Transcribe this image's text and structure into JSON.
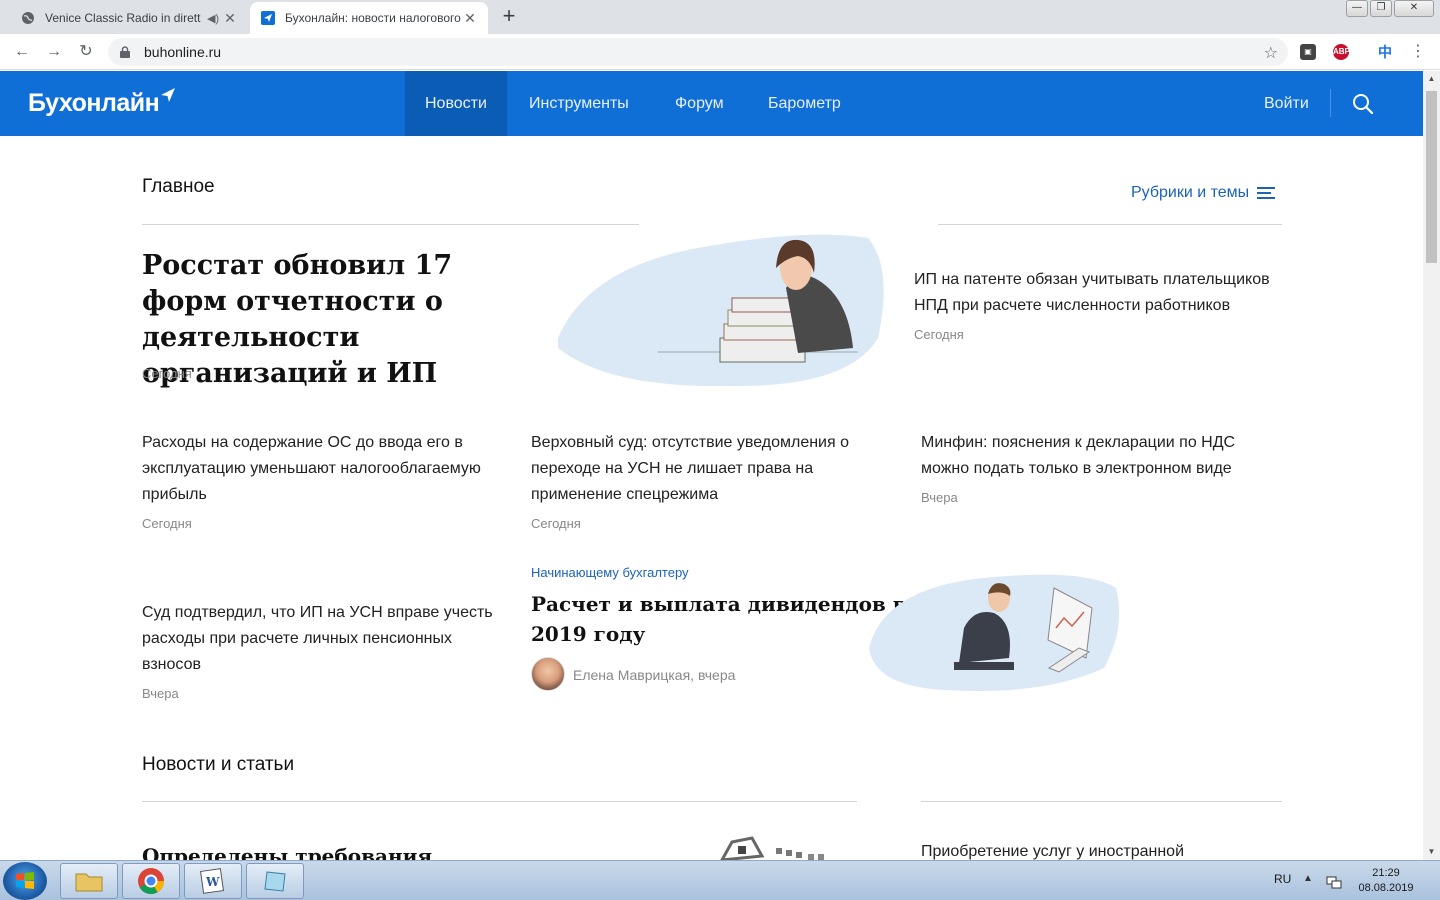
{
  "browser": {
    "tabs": [
      {
        "title": "Venice Classic Radio in dirett",
        "active": false
      },
      {
        "title": "Бухонлайн: новости налогового",
        "active": true
      }
    ],
    "url": "buhonline.ru",
    "ext_abp": "ABP"
  },
  "site": {
    "logo": "Бухонлайн",
    "nav": [
      "Новости",
      "Инструменты",
      "Форум",
      "Барометр"
    ],
    "login": "Войти"
  },
  "main": {
    "section_title": "Главное",
    "rubrics_label": "Рубрики и темы",
    "lead": {
      "title": "Росстат обновил 17 форм отчетности о деятельности организаций и ИП",
      "date": "Сегодня"
    },
    "side": {
      "title": "ИП на патенте обязан учитывать плательщиков НПД при расчете численности работников",
      "date": "Сегодня"
    },
    "row": [
      {
        "title": "Расходы на содержание ОС до ввода его в эксплуатацию уменьшают налогооблагаемую прибыль",
        "date": "Сегодня"
      },
      {
        "title": "Верховный суд: отсутствие уведомления о переходе на УСН не лишает права на применение спецрежима",
        "date": "Сегодня"
      },
      {
        "title": "Минфин: пояснения к декларации по НДС можно подать только в электронном виде",
        "date": "Вчера"
      }
    ],
    "left_article": {
      "title": "Суд подтвердил, что ИП на УСН вправе учесть расходы при расчете личных пенсионных взносов",
      "date": "Вчера"
    },
    "featured": {
      "category": "Начинающему бухгалтеру",
      "title": "Расчет и выплата дивидендов в 2019 году",
      "byline": "Елена Маврицкая, вчера"
    }
  },
  "news": {
    "section_title": "Новости и статьи",
    "lead_title": "Определены требования",
    "side_title": "Приобретение услуг у иностранной"
  },
  "taskbar": {
    "lang": "RU",
    "time": "21:29",
    "date": "08.08.2019"
  },
  "colors": {
    "header_blue": "#0f6fd7",
    "nav_active": "#0b5cb5",
    "link_blue": "#1b63b7"
  }
}
